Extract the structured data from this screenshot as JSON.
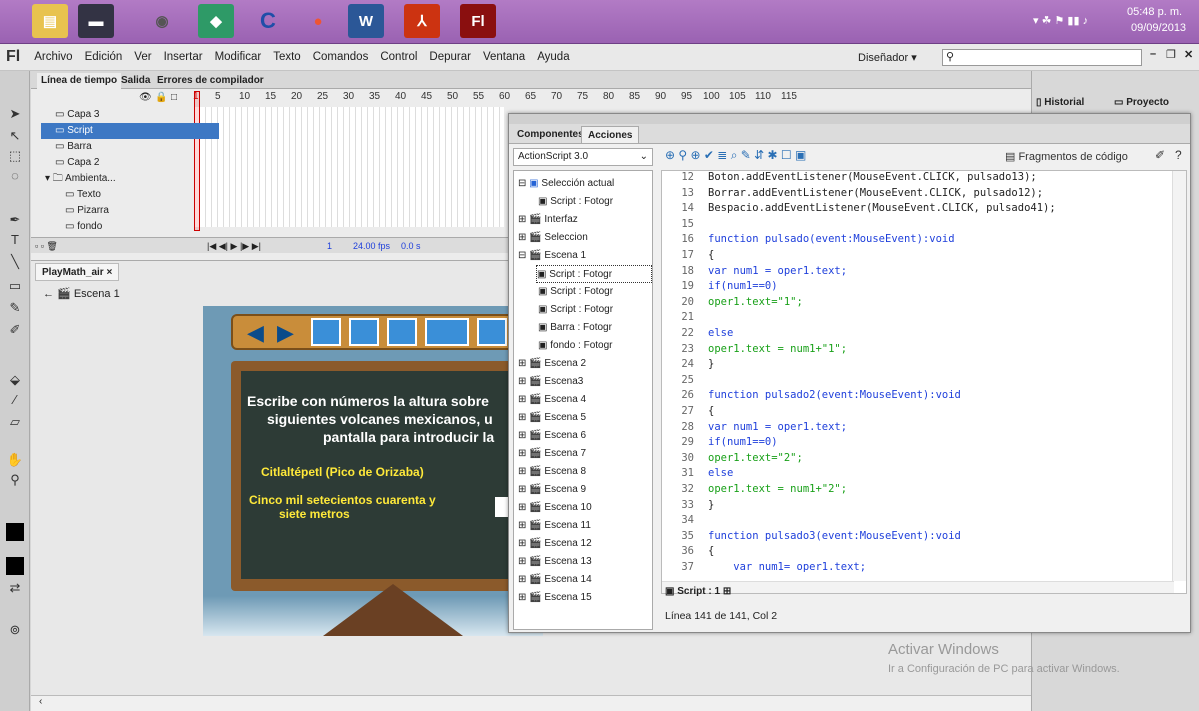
{
  "taskbar": {
    "clock": {
      "time": "05:48 p. m.",
      "date": "09/09/2013"
    }
  },
  "menubar": {
    "logo": "Fl",
    "items": [
      "Archivo",
      "Edición",
      "Ver",
      "Insertar",
      "Modificar",
      "Texto",
      "Comandos",
      "Control",
      "Depurar",
      "Ventana",
      "Ayuda"
    ],
    "workspace": "Diseñador",
    "search_placeholder": ""
  },
  "timeline": {
    "tabs": [
      "Línea de tiempo",
      "Salida",
      "Errores de compilador"
    ],
    "frame_numbers": [
      "1",
      "5",
      "10",
      "15",
      "20",
      "25",
      "30",
      "35",
      "40",
      "45",
      "50",
      "55",
      "60",
      "65",
      "70",
      "75",
      "80",
      "85",
      "90",
      "95",
      "100",
      "105",
      "110",
      "115"
    ],
    "layers": [
      {
        "name": "Capa 3"
      },
      {
        "name": "Script"
      },
      {
        "name": "Barra"
      },
      {
        "name": "Capa 2"
      },
      {
        "name": "Ambienta..."
      },
      {
        "name": "Texto"
      },
      {
        "name": "Pizarra"
      },
      {
        "name": "fondo"
      }
    ],
    "status": {
      "frame": "1",
      "fps": "24.00 fps",
      "time": "0.0 s"
    }
  },
  "right_panel": {
    "historial": "Historial",
    "proyecto": "Proyecto"
  },
  "document": {
    "tab": "PlayMath_air",
    "scene": "Escena 1",
    "board_text": {
      "line1": "Escribe con números la altura sobre",
      "line2": "siguientes volcanes mexicanos, u",
      "line3": "pantalla para introducir la",
      "volcano": "Citlaltépetl (Pico de Orizaba)",
      "answer1": "Cinco mil setecientos cuarenta y",
      "answer2": "siete metros"
    }
  },
  "actions_panel": {
    "tabs": [
      "Componentes",
      "Acciones"
    ],
    "language": "ActionScript 3.0",
    "snippets": "Fragmentos de código",
    "tree": [
      "Selección actual",
      "Script : Fotogr",
      "Interfaz",
      "Seleccion",
      "Escena 1",
      "Script : Fotogr",
      "Script : Fotogr",
      "Script : Fotogr",
      "Barra : Fotogr",
      "fondo : Fotogr",
      "Escena 2",
      "Escena3",
      "Escena 4",
      "Escena 5",
      "Escena 6",
      "Escena 7",
      "Escena 8",
      "Escena 9",
      "Escena 10",
      "Escena 11",
      "Escena 12",
      "Escena 13",
      "Escena 14",
      "Escena 15"
    ],
    "code_lines": [
      {
        "n": "12",
        "t": "Boton.addEventListener(MouseEvent.CLICK, pulsado13);"
      },
      {
        "n": "13",
        "t": "Borrar.addEventListener(MouseEvent.CLICK, pulsado12);"
      },
      {
        "n": "14",
        "t": "Bespacio.addEventListener(MouseEvent.CLICK, pulsado41);"
      },
      {
        "n": "15",
        "t": ""
      },
      {
        "n": "16",
        "t": "function pulsado(event:MouseEvent):void"
      },
      {
        "n": "17",
        "t": "{"
      },
      {
        "n": "18",
        "t": "var num1 = oper1.text;"
      },
      {
        "n": "19",
        "t": "if(num1==0)"
      },
      {
        "n": "20",
        "t": "oper1.text=\"1\";"
      },
      {
        "n": "21",
        "t": ""
      },
      {
        "n": "22",
        "t": "else"
      },
      {
        "n": "23",
        "t": "oper1.text = num1+\"1\";"
      },
      {
        "n": "24",
        "t": "}"
      },
      {
        "n": "25",
        "t": ""
      },
      {
        "n": "26",
        "t": "function pulsado2(event:MouseEvent):void"
      },
      {
        "n": "27",
        "t": "{"
      },
      {
        "n": "28",
        "t": "var num1 = oper1.text;"
      },
      {
        "n": "29",
        "t": "if(num1==0)"
      },
      {
        "n": "30",
        "t": "oper1.text=\"2\";"
      },
      {
        "n": "31",
        "t": "else"
      },
      {
        "n": "32",
        "t": "oper1.text = num1+\"2\";"
      },
      {
        "n": "33",
        "t": "}"
      },
      {
        "n": "34",
        "t": ""
      },
      {
        "n": "35",
        "t": "function pulsado3(event:MouseEvent):void"
      },
      {
        "n": "36",
        "t": "{"
      },
      {
        "n": "37",
        "t": "    var num1= oper1.text;"
      }
    ],
    "script_tab": "Script : 1",
    "status": "Línea 141 de 141, Col 2"
  },
  "watermark": {
    "title": "Activar Windows",
    "subtitle": "Ir a Configuración de PC para activar Windows."
  }
}
